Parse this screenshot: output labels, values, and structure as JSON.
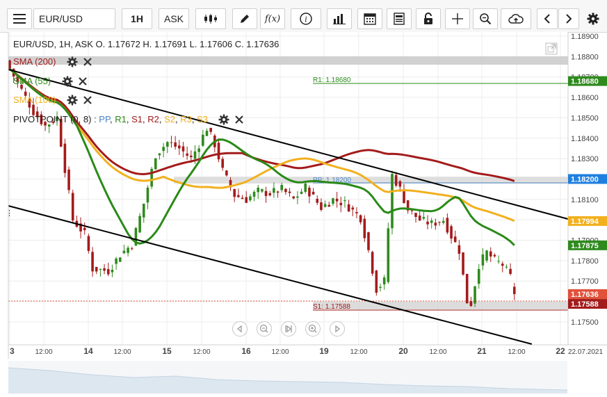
{
  "toolbar": {
    "symbol": "EUR/USD",
    "interval": "1H",
    "price_type": "ASK",
    "icons": [
      "menu-icon",
      "candlestick-type-icon",
      "draw-pencil-icon",
      "function-icon",
      "info-icon",
      "indicators-bar-icon",
      "calendar-icon",
      "news-icon",
      "lock-icon",
      "crosshair-icon",
      "zoom-icon",
      "cloud-upload-icon",
      "scroll-left-icon",
      "scroll-right-icon",
      "gear-icon"
    ]
  },
  "chart": {
    "ohlc_label": "EUR/USD, 1H, ASK   O. 1.17672 H. 1.17691 L. 1.17606 C. 1.17636",
    "indicators": [
      {
        "label": "SMA (200)",
        "color": "#a31b1b"
      },
      {
        "label": "SMA (55)",
        "color": "#2a8a17"
      },
      {
        "label": "SMA (100)",
        "color": "#f2b01e"
      }
    ],
    "pivot": {
      "label": "PIVOTPOINT (0, 8)",
      "items": [
        {
          "text": "PP",
          "color": "#4a86c5"
        },
        {
          "text": "R1",
          "color": "#2a8a17"
        },
        {
          "text": "S1",
          "color": "#a31b1b"
        },
        {
          "text": "R2",
          "color": "#a31b1b"
        },
        {
          "text": "S2",
          "color": "#f2b01e"
        },
        {
          "text": "R3",
          "color": "#f2b01e"
        },
        {
          "text": "S3",
          "color": "#f2b01e"
        }
      ]
    },
    "level_labels": {
      "r1": "R1: 1.18680",
      "pp": "PP: 1.18200",
      "s1": "S1: 1.17588"
    },
    "price_ticks": [
      "1.18900",
      "1.18800",
      "1.18700",
      "1.18600",
      "1.18500",
      "1.18400",
      "1.18300",
      "1.18200",
      "1.18100",
      "1.18000",
      "1.17900",
      "1.17800",
      "1.17700",
      "1.17600",
      "1.17500"
    ],
    "price_tags": [
      {
        "text": "1.18680",
        "color": "#2f8a1e"
      },
      {
        "text": "1.18200",
        "color": "#1f7fe0"
      },
      {
        "text": "1.17994",
        "color": "#f2b01e"
      },
      {
        "text": "1.17875",
        "color": "#2f8a1e"
      },
      {
        "text": "1.17636",
        "color": "#e0523a"
      },
      {
        "text": "1.17588",
        "color": "#a31b1b"
      }
    ],
    "time_ticks": [
      "3",
      "12:00",
      "14",
      "12:00",
      "15",
      "12:00",
      "16",
      "12:00",
      "19",
      "12:00",
      "20",
      "12:00",
      "21",
      "12:00",
      "22",
      "22.07.2021"
    ],
    "colors": {
      "up": "#2f8a1e",
      "down": "#a31b1b",
      "sma200": "#a31b1b",
      "sma55": "#2a8a17",
      "sma100": "#f2b01e",
      "channel": "#000000",
      "pp": "#4a86c5",
      "r1": "#2a8a17",
      "s1": "#a31b1b"
    }
  },
  "chart_data": {
    "type": "candlestick",
    "symbol": "EUR/USD",
    "timeframe": "1H",
    "ylim": [
      1.1744,
      1.1894
    ],
    "x_labels": [
      "3",
      "14",
      "15",
      "16",
      "19",
      "20",
      "21",
      "22"
    ],
    "last_candle": {
      "open": 1.17672,
      "high": 1.17691,
      "low": 1.17606,
      "close": 1.17636
    },
    "levels": {
      "R1": 1.1868,
      "PP": 1.182,
      "S1": 1.17588
    },
    "sma_last": {
      "SMA (200)": 1.1819,
      "SMA (55)": 1.17875,
      "SMA (100)": 1.17994
    },
    "anchors_close": [
      [
        0,
        1.1874
      ],
      [
        6,
        1.1853
      ],
      [
        9,
        1.1846
      ],
      [
        12,
        1.185
      ],
      [
        14,
        1.1825
      ],
      [
        16,
        1.18
      ],
      [
        19,
        1.1793
      ],
      [
        21,
        1.1776
      ],
      [
        25,
        1.1775
      ],
      [
        28,
        1.1783
      ],
      [
        31,
        1.1788
      ],
      [
        34,
        1.1808
      ],
      [
        37,
        1.1832
      ],
      [
        40,
        1.1838
      ],
      [
        43,
        1.1835
      ],
      [
        46,
        1.183
      ],
      [
        48,
        1.1837
      ],
      [
        50,
        1.1845
      ],
      [
        52,
        1.1837
      ],
      [
        54,
        1.1824
      ],
      [
        57,
        1.1812
      ],
      [
        60,
        1.181
      ],
      [
        63,
        1.1814
      ],
      [
        66,
        1.1813
      ],
      [
        69,
        1.1815
      ],
      [
        72,
        1.181
      ],
      [
        75,
        1.1816
      ],
      [
        79,
        1.1806
      ],
      [
        82,
        1.181
      ],
      [
        85,
        1.1808
      ],
      [
        89,
        1.1801
      ],
      [
        91,
        1.1785
      ],
      [
        93,
        1.1766
      ],
      [
        95,
        1.177
      ],
      [
        97,
        1.1822
      ],
      [
        99,
        1.1815
      ],
      [
        101,
        1.1805
      ],
      [
        104,
        1.18
      ],
      [
        107,
        1.1798
      ],
      [
        110,
        1.18
      ],
      [
        112,
        1.1792
      ],
      [
        114,
        1.1785
      ],
      [
        116,
        1.176
      ],
      [
        117,
        1.1759
      ],
      [
        119,
        1.1778
      ],
      [
        121,
        1.1784
      ],
      [
        123,
        1.178
      ],
      [
        125,
        1.1778
      ],
      [
        127,
        1.1772
      ],
      [
        128,
        1.1764
      ]
    ]
  }
}
